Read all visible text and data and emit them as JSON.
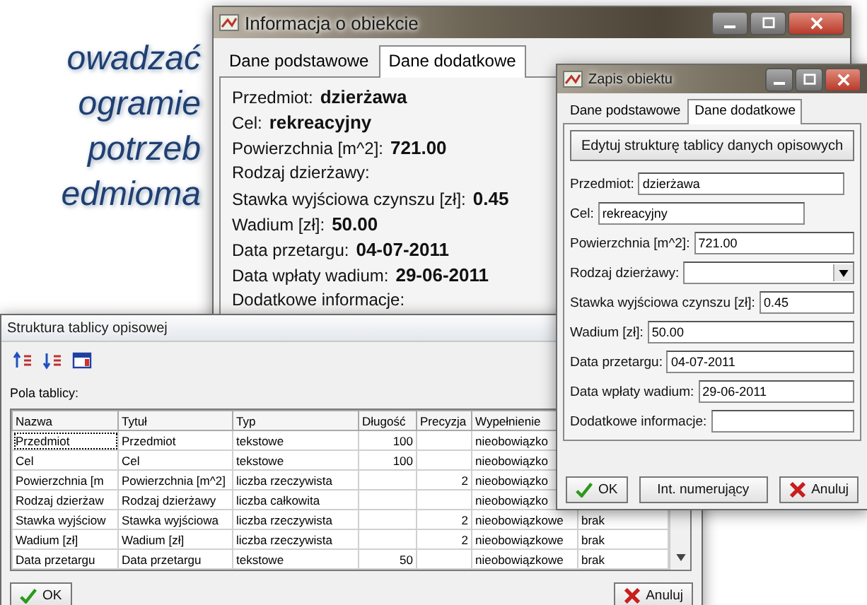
{
  "slogan": {
    "lines": [
      "owadzać",
      "ogramie",
      "potrzeb",
      "edmioma"
    ]
  },
  "info_window": {
    "title": "Informacja o obiekcie",
    "tabs": [
      {
        "label": "Dane podstawowe",
        "selected": false
      },
      {
        "label": "Dane dodatkowe",
        "selected": true
      }
    ],
    "fields": [
      {
        "label": "Przedmiot:",
        "value": "dzierżawa"
      },
      {
        "label": "Cel:",
        "value": "rekreacyjny"
      },
      {
        "label": "Powierzchnia [m^2]:",
        "value": "721.00"
      },
      {
        "label": "Rodzaj dzierżawy:"
      },
      {
        "label": "Stawka wyjściowa czynszu [zł]:",
        "value": "0.45"
      },
      {
        "label": "Wadium [zł]:",
        "value": "50.00"
      },
      {
        "label": "Data przetargu:",
        "value": "04-07-2011"
      },
      {
        "label": "Data wpłaty wadium:",
        "value": "29-06-2011"
      },
      {
        "label": "Dodatkowe informacje:"
      }
    ]
  },
  "record_window": {
    "title": "Zapis obiektu",
    "tabs": [
      {
        "label": "Dane podstawowe",
        "selected": false
      },
      {
        "label": "Dane dodatkowe",
        "selected": true
      }
    ],
    "edit_button": "Edytuj strukturę tablicy danych opisowych",
    "fields": [
      {
        "label": "Przedmiot:",
        "kind": "text",
        "value": "dzierżawa"
      },
      {
        "label": "Cel:",
        "kind": "text",
        "value": "rekreacyjny"
      },
      {
        "label": "Powierzchnia [m^2]:",
        "kind": "text",
        "value": "721.00"
      },
      {
        "label": "Rodzaj dzierżawy:",
        "kind": "dropdown"
      },
      {
        "label": "Stawka wyjściowa czynszu [zł]:",
        "kind": "text",
        "value": "0.45"
      },
      {
        "label": "Wadium [zł]:",
        "kind": "text",
        "value": "50.00"
      },
      {
        "label": "Data przetargu:",
        "kind": "text",
        "value": "04-07-2011"
      },
      {
        "label": "Data wpłaty wadium:",
        "kind": "text",
        "value": "29-06-2011"
      },
      {
        "label": "Dodatkowe informacje:",
        "kind": "text"
      }
    ],
    "buttons": [
      {
        "label": "OK",
        "kind": "ok"
      },
      {
        "label": "Int. numerujący",
        "kind": "plain"
      },
      {
        "label": "Anuluj",
        "kind": "cancel"
      }
    ]
  },
  "structure_window": {
    "title": "Struktura tablicy opisowej",
    "fields_label": "Pola tablicy:",
    "table": {
      "columns": [
        "Nazwa",
        "Tytuł",
        "Typ",
        "Długość",
        "Precyzja",
        "Wypełnienie"
      ],
      "rows": [
        {
          "selected": true,
          "cells": [
            "Przedmiot",
            "Przedmiot",
            "tekstowe",
            "100",
            null,
            "nieobowiązko",
            null
          ]
        },
        {
          "selected": false,
          "cells": [
            "Cel",
            "Cel",
            "tekstowe",
            "100",
            null,
            "nieobowiązko",
            null
          ]
        },
        {
          "selected": false,
          "cells": [
            "Powierzchnia [m",
            "Powierzchnia [m^2]",
            "liczba rzeczywista",
            null,
            "2",
            "nieobowiązko",
            null
          ]
        },
        {
          "selected": false,
          "cells": [
            "Rodzaj dzierżaw",
            "Rodzaj dzierżawy",
            "liczba całkowita",
            null,
            null,
            "nieobowiązko",
            null
          ]
        },
        {
          "selected": false,
          "cells": [
            "Stawka wyjściow",
            "Stawka wyjściowa",
            "liczba rzeczywista",
            null,
            "2",
            "nieobowiązkowe",
            "brak"
          ]
        },
        {
          "selected": false,
          "cells": [
            "Wadium [zł]",
            "Wadium [zł]",
            "liczba rzeczywista",
            null,
            "2",
            "nieobowiązkowe",
            "brak"
          ]
        },
        {
          "selected": false,
          "cells": [
            "Data przetargu",
            "Data przetargu",
            "tekstowe",
            "50",
            null,
            "nieobowiązkowe",
            "brak"
          ]
        }
      ]
    },
    "buttons": [
      {
        "label": "OK",
        "kind": "ok"
      },
      {
        "label": "Anuluj",
        "kind": "cancel"
      }
    ]
  }
}
